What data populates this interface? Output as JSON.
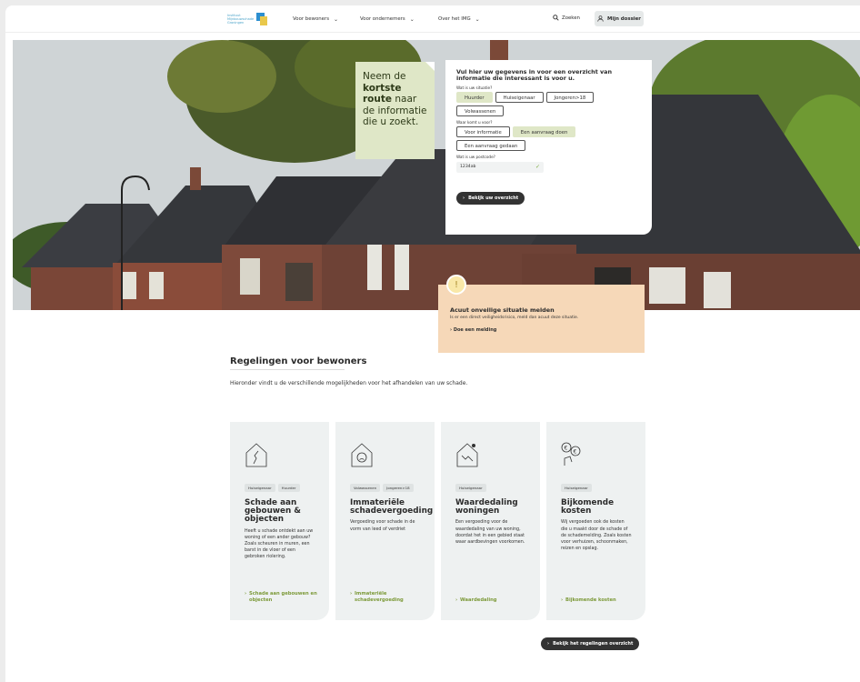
{
  "header": {
    "logo_text": "Instituut Mijnbouwschade Groningen",
    "nav": [
      {
        "label": "Voor bewoners"
      },
      {
        "label": "Voor ondernemers"
      },
      {
        "label": "Over het IMG"
      }
    ],
    "search_label": "Zoeken",
    "dossier_label": "Mijn dossier"
  },
  "hero": {
    "quote_line1": "Neem de",
    "quote_bold": "kortste route",
    "quote_line2": "naar de informatie die u zoekt."
  },
  "form": {
    "title": "Vul hier uw gegevens in voor een overzicht van informatie die interessant is voor u.",
    "situation_label": "Wat is uw situatie?",
    "situation_options": [
      "Huurder",
      "Huiseigenaar",
      "Jongeren>18",
      "Volwassenen"
    ],
    "situation_selected": "Huurder",
    "purpose_label": "Waar komt u voor?",
    "purpose_options": [
      "Voor informatie",
      "Een aanvraag doen",
      "Een aanvraag gedaan"
    ],
    "purpose_selected": "Een aanvraag doen",
    "postcode_label": "Wat is uw postcode?",
    "postcode_value": "1234ab",
    "submit_label": "Bekijk uw overzicht"
  },
  "alert": {
    "title": "Acuut onveilige situatie melden",
    "description": "Is er een direct veiligheidsrisico, meld dan acuut deze situatie.",
    "link": "Doe een melding"
  },
  "section": {
    "title": "Regelingen voor bewoners",
    "intro": "Hieronder vindt u de verschillende mogelijkheden voor het afhandelen van uw schade."
  },
  "cards": [
    {
      "icon": "house-crack-icon",
      "tags": [
        "Huiseigenaar",
        "Huurder"
      ],
      "title": "Schade aan gebouwen & objecten",
      "description": "Heeft u schade ontdekt aan uw woning of een ander gebouw? Zoals scheuren in muren, een barst in de vloer of een gebroken riolering.",
      "link": "Schade aan gebouwen en objecten"
    },
    {
      "icon": "house-sad-face-icon",
      "tags": [
        "Volwassenen",
        "Jongeren>18"
      ],
      "title": "Immateriële schadevergoeding",
      "description": "Vergoeding voor schade in de vorm van leed of verdriet",
      "link": "Immateriële schadevergoeding"
    },
    {
      "icon": "house-decline-icon",
      "tags": [
        "Huiseigenaar"
      ],
      "title": "Waardedaling woningen",
      "description": "Een vergoeding voor de waardedaling van uw woning, doordat het in een gebied staat waar aardbevingen voorkomen.",
      "link": "Waardedaling"
    },
    {
      "icon": "euro-coins-icon",
      "tags": [
        "Huiseigenaar"
      ],
      "title": "Bijkomende kosten",
      "description": "Wij vergoeden ook de kosten die u maakt door de schade of de schademelding. Zoals kosten voor verhuizen, schoonmaken, reizen en opslag.",
      "link": "Bijkomende kosten"
    }
  ],
  "overview_label": "Bekijk het regelingen overzicht",
  "colors": {
    "accent_green": "#dfe7c7",
    "link_green": "#7d9a3a",
    "alert_bg": "#f6d8b8",
    "dark_button": "#333333"
  }
}
